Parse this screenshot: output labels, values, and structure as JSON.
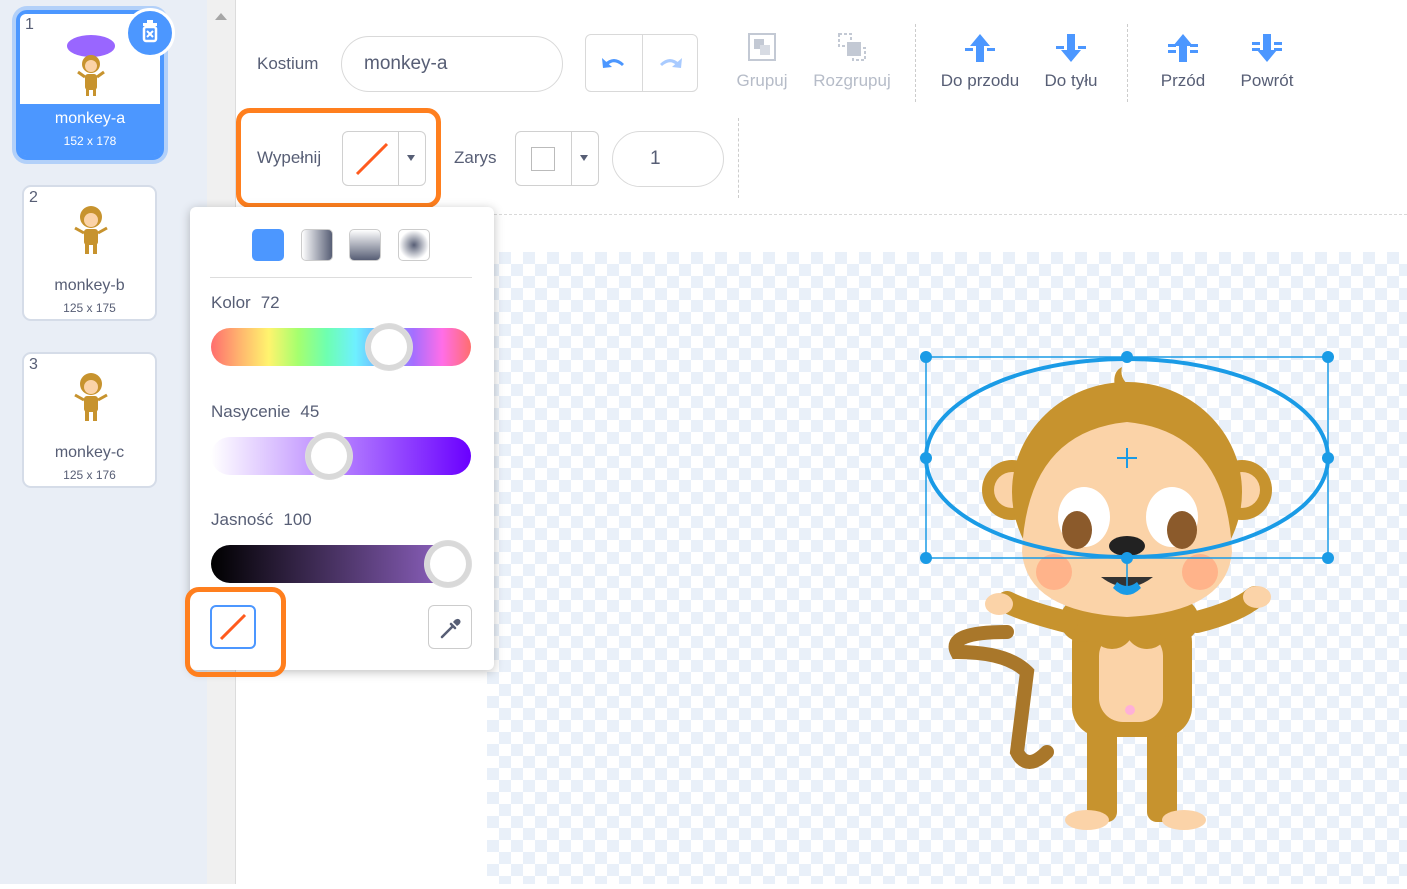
{
  "costumes": [
    {
      "number": "1",
      "name": "monkey-a",
      "size": "152 x 178",
      "selected": true
    },
    {
      "number": "2",
      "name": "monkey-b",
      "size": "125 x 175",
      "selected": false
    },
    {
      "number": "3",
      "name": "monkey-c",
      "size": "125 x 176",
      "selected": false
    }
  ],
  "toolbar": {
    "costume_label": "Kostium",
    "costume_name": "monkey-a",
    "group": "Grupuj",
    "ungroup": "Rozgrupuj",
    "forward": "Do przodu",
    "backward": "Do tyłu",
    "front": "Przód",
    "back": "Powrót",
    "fill_label": "Wypełnij",
    "outline_label": "Zarys",
    "outline_width": "1"
  },
  "popover": {
    "color_label": "Kolor",
    "color_value": "72",
    "saturation_label": "Nasycenie",
    "saturation_value": "45",
    "brightness_label": "Jasność",
    "brightness_value": "100",
    "color_fraction": 0.72,
    "saturation_fraction": 0.45,
    "brightness_fraction": 1.0
  },
  "colors": {
    "accent": "#4c97ff",
    "highlight": "#ff7f1e",
    "no_fill_slash": "#ff5b1e",
    "selection": "#1a9be6"
  }
}
